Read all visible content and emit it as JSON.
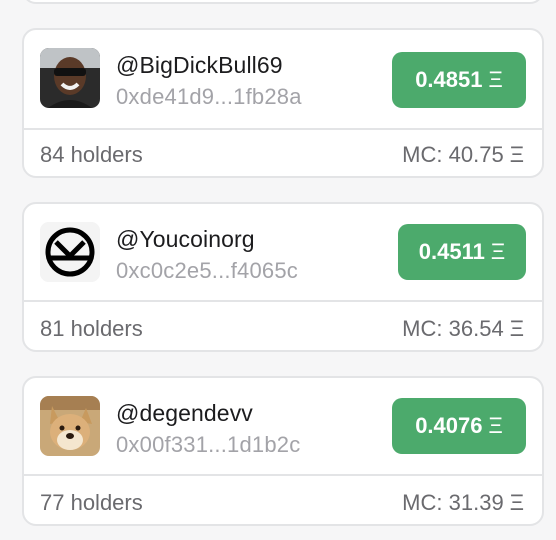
{
  "currency_symbol": "Ξ",
  "tokens": [
    {
      "handle": "@BigDickBull69",
      "address": "0xde41d9...1fb28a",
      "price": "0.4851",
      "holders": "84 holders",
      "mc_label": "MC:",
      "mc_value": "40.75",
      "avatar": "person-sunglasses-avatar"
    },
    {
      "handle": "@Youcoinorg",
      "address": "0xc0c2e5...f4065c",
      "price": "0.4511",
      "holders": "81 holders",
      "mc_label": "MC:",
      "mc_value": "36.54",
      "avatar": "youcoin-logo-avatar"
    },
    {
      "handle": "@degendevv",
      "address": "0x00f331...1d1b2c",
      "price": "0.4076",
      "holders": "77 holders",
      "mc_label": "MC:",
      "mc_value": "31.39",
      "avatar": "doge-avatar"
    }
  ],
  "colors": {
    "accent_green": "#4caa6c",
    "border": "#e3e4e6",
    "muted_text": "#a3a3a8"
  }
}
